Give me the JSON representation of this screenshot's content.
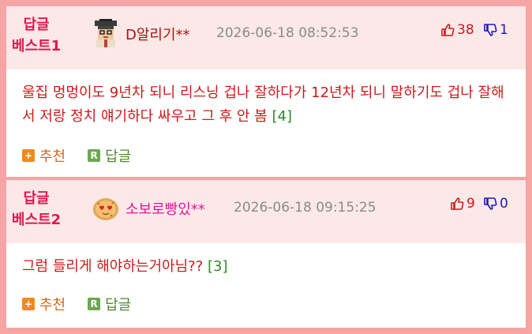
{
  "comments": [
    {
      "best_line1": "답글",
      "best_line2": "베스트1",
      "nickname": "D알리기**",
      "nickname_color": "#b01010",
      "date": "2026-06-18 08:52:53",
      "likes": "38",
      "dislikes": "1",
      "text": "울집 멍멍이도 9년차 되니 리스닝 겁나 잘하다가 12년차 되니 말하기도 겁나 잘해서 저랑 정치 얘기하다 싸우고 그 후 안 봄",
      "reply_count": "[4]",
      "recommend_label": "추천",
      "reply_label": "답글"
    },
    {
      "best_line1": "답글",
      "best_line2": "베스트2",
      "nickname": "소보로빵있**",
      "nickname_color": "#e0189a",
      "date": "2026-06-18 09:15:25",
      "likes": "9",
      "dislikes": "0",
      "text": "그럼 들리게 해야하는거아님??",
      "reply_count": "[3]",
      "recommend_label": "추천",
      "reply_label": "답글"
    }
  ],
  "colors": {
    "frame": "#f6a4a4",
    "header_bg": "#fde8e8",
    "best_label": "#e0174f",
    "body_text": "#cc1a1a",
    "reply_count": "#2e8a2e",
    "like": "#cc1a1a",
    "dislike": "#1a1ab8"
  },
  "icons": {
    "avatar1": "graduate-pixel-avatar-icon",
    "avatar2": "bread-heart-eyes-avatar-icon",
    "like": "thumbs-up-icon",
    "dislike": "thumbs-down-icon",
    "recommend": "plus-square-icon",
    "reply": "r-square-icon"
  }
}
